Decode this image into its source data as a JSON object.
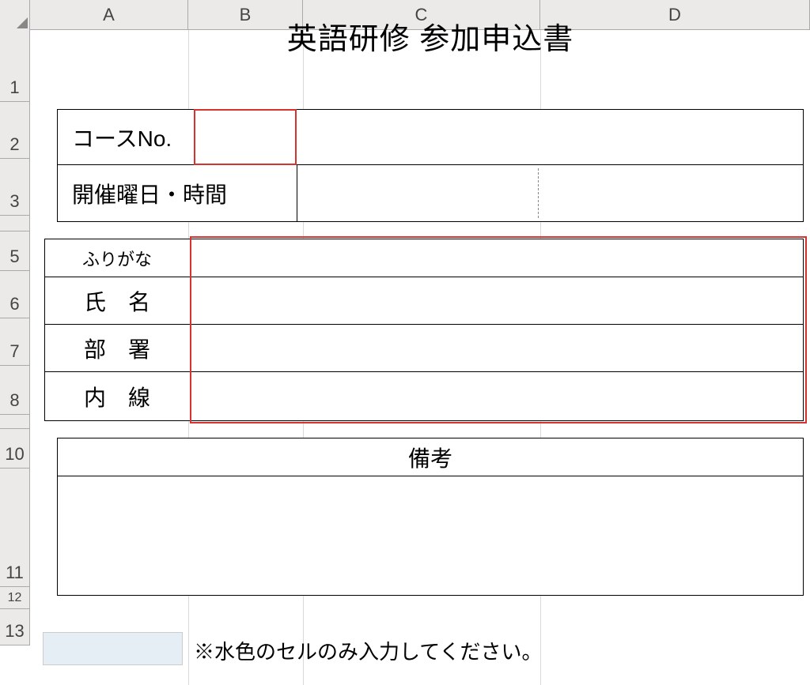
{
  "columns": {
    "A": "A",
    "B": "B",
    "C": "C",
    "D": "D"
  },
  "rows": {
    "r1": "1",
    "r2": "2",
    "r3": "3",
    "r5": "5",
    "r6": "6",
    "r7": "7",
    "r8": "8",
    "r10": "10",
    "r11": "11",
    "r12": "12",
    "r13": "13"
  },
  "title": "英語研修 参加申込書",
  "form": {
    "course_no_label": "コースNo.",
    "schedule_label": "開催曜日・時間",
    "furigana_label": "ふりがな",
    "name_label": "氏　名",
    "dept_label": "部　署",
    "ext_label": "内　線",
    "remarks_label": "備考"
  },
  "note": "※水色のセルのみ入力してください。"
}
